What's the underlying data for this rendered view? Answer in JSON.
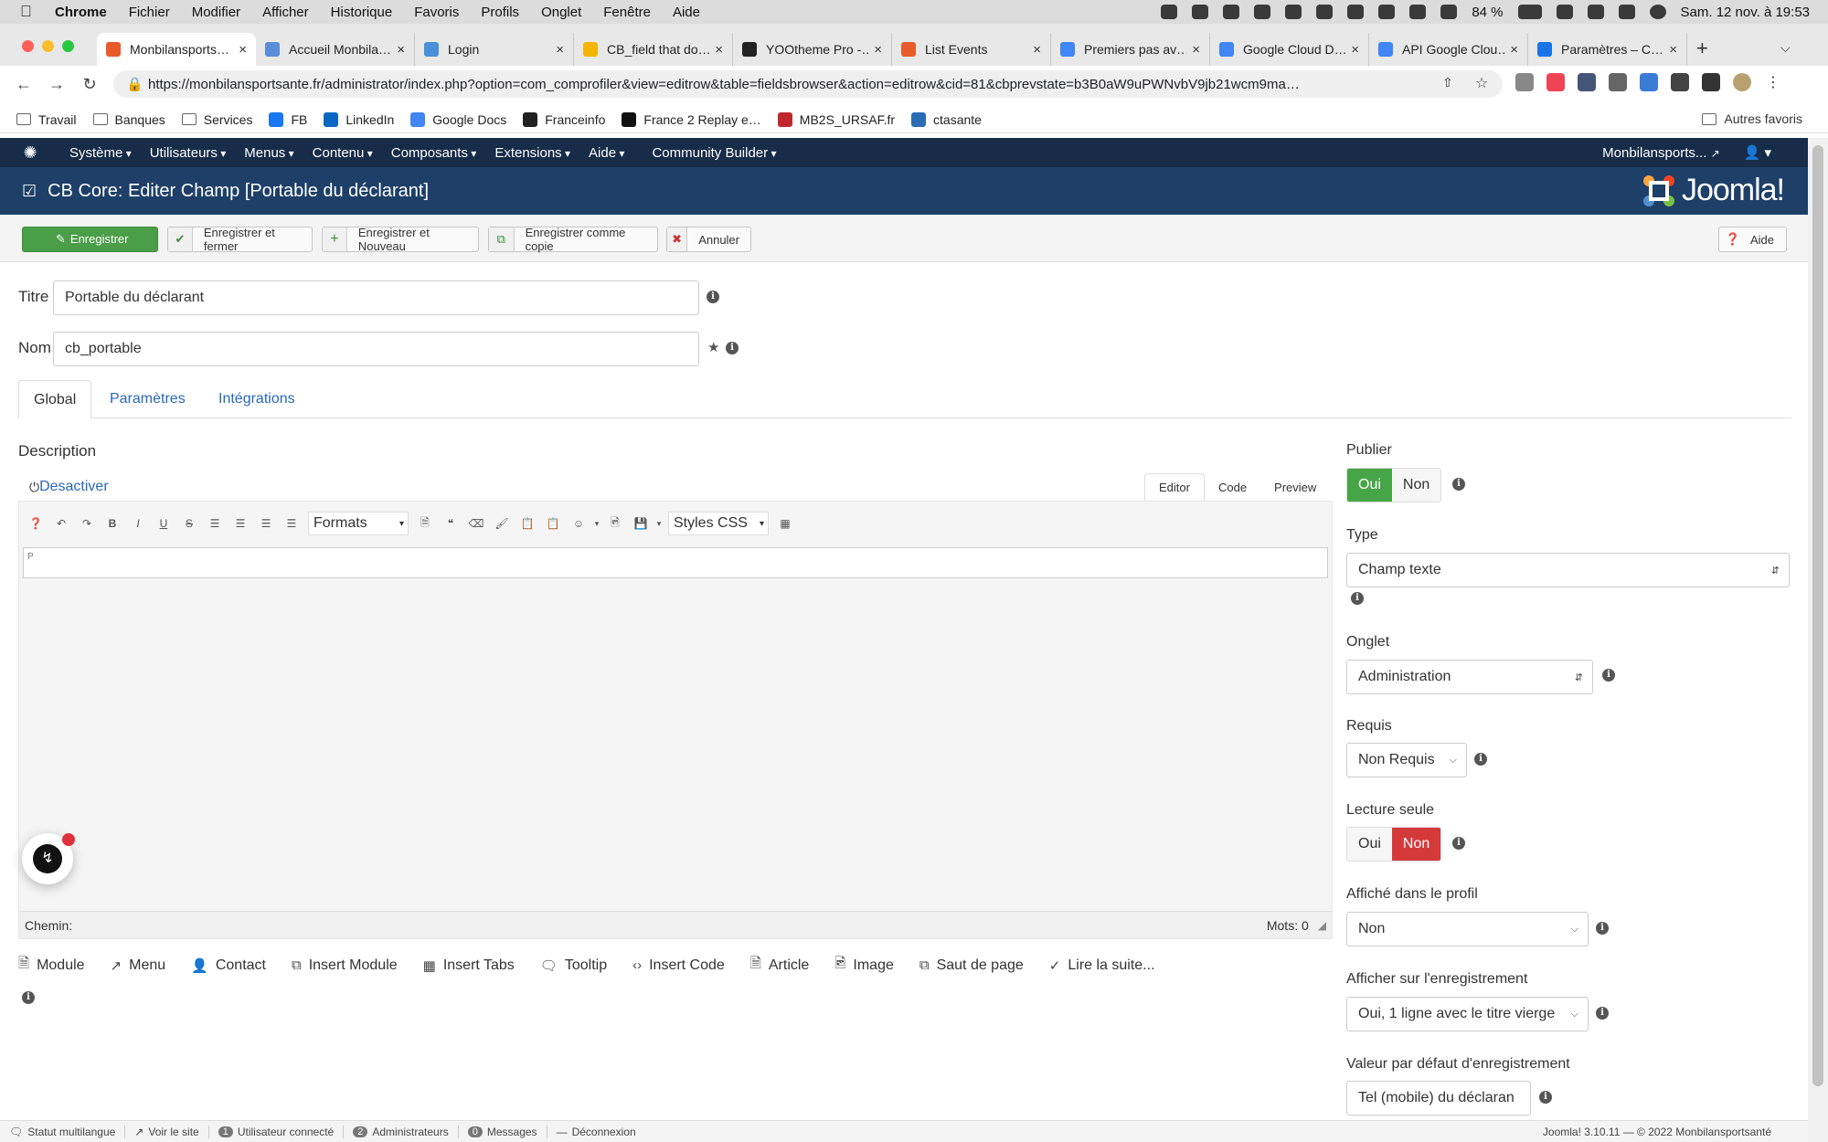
{
  "mac": {
    "app": "Chrome",
    "menus": [
      "Fichier",
      "Modifier",
      "Afficher",
      "Historique",
      "Favoris",
      "Profils",
      "Onglet",
      "Fenêtre",
      "Aide"
    ],
    "battery": "84 %",
    "clock": "Sam. 12 nov. à 19:53"
  },
  "browser": {
    "tabs": [
      {
        "title": "Monbilansports…",
        "color": "#e85c2c"
      },
      {
        "title": "Accueil Monbila…",
        "color": "#5b8dd8"
      },
      {
        "title": "Login",
        "color": "#4a90d9"
      },
      {
        "title": "CB_field that do…",
        "color": "#f2b600"
      },
      {
        "title": "YOOtheme Pro -…",
        "color": "#222222"
      },
      {
        "title": "List Events",
        "color": "#e85c2c"
      },
      {
        "title": "Premiers pas av…",
        "color": "#4285f4"
      },
      {
        "title": "Google Cloud D…",
        "color": "#4285f4"
      },
      {
        "title": "API Google Clou…",
        "color": "#4285f4"
      },
      {
        "title": "Paramètres – C…",
        "color": "#1a73e8"
      }
    ],
    "url_host": "https://monbilansportsante.fr",
    "url_path": "/administrator/index.php?option=com_comprofiler&view=editrow&table=fieldsbrowser&action=editrow&cid=81&cbprevstate=b3B0aW9uPWNvbV9jb21wcm9ma…",
    "bookmarks": [
      {
        "label": "Travail",
        "type": "folder"
      },
      {
        "label": "Banques",
        "type": "folder"
      },
      {
        "label": "Services",
        "type": "folder"
      },
      {
        "label": "FB",
        "type": "site",
        "color": "#1877f2"
      },
      {
        "label": "LinkedIn",
        "type": "site",
        "color": "#0a66c2"
      },
      {
        "label": "Google Docs",
        "type": "site",
        "color": "#4285f4"
      },
      {
        "label": "Franceinfo",
        "type": "site",
        "color": "#222222"
      },
      {
        "label": "France 2 Replay e…",
        "type": "site",
        "color": "#111111"
      },
      {
        "label": "MB2S_URSAF.fr",
        "type": "site",
        "color": "#c0272d"
      },
      {
        "label": "ctasante",
        "type": "site",
        "color": "#2a6db5"
      }
    ],
    "bookmarks_other": "Autres favoris"
  },
  "joomla": {
    "nav": [
      "Système",
      "Utilisateurs",
      "Menus",
      "Contenu",
      "Composants",
      "Extensions",
      "Aide",
      "Community Builder"
    ],
    "site_link": "Monbilansports...",
    "page_title": "CB Core: Editer Champ [Portable du déclarant]",
    "brand": "Joomla!",
    "toolbar": {
      "save": "Enregistrer",
      "save_close": "Enregistrer et fermer",
      "save_new": "Enregistrer et Nouveau",
      "save_copy": "Enregistrer comme copie",
      "cancel": "Annuler",
      "help": "Aide"
    },
    "form": {
      "title_label": "Titre",
      "title_value": "Portable du déclarant",
      "name_label": "Nom",
      "name_value": "cb_portable"
    },
    "tabs": [
      "Global",
      "Paramètres",
      "Intégrations"
    ],
    "description_label": "Description",
    "editor": {
      "toggle": "Desactiver",
      "modes": [
        "Editor",
        "Code",
        "Preview"
      ],
      "formats": "Formats",
      "styles": "Styles CSS",
      "content": "P",
      "path_label": "Chemin:",
      "words": "Mots: 0"
    },
    "editor_buttons": [
      "Module",
      "Menu",
      "Contact",
      "Insert Module",
      "Insert Tabs",
      "Tooltip",
      "Insert Code",
      "Article",
      "Image",
      "Saut de page",
      "Lire la suite..."
    ],
    "right": {
      "publier_label": "Publier",
      "publier_yes": "Oui",
      "publier_no": "Non",
      "type_label": "Type",
      "type_value": "Champ texte",
      "onglet_label": "Onglet",
      "onglet_value": "Administration",
      "requis_label": "Requis",
      "requis_value": "Non Requis",
      "lecture_label": "Lecture seule",
      "lecture_yes": "Oui",
      "lecture_no": "Non",
      "profil_label": "Affiché dans le profil",
      "profil_value": "Non",
      "enreg_label": "Afficher sur l'enregistrement",
      "enreg_value": "Oui, 1 ligne avec le titre vierge",
      "defaut_label": "Valeur par défaut d'enregistrement",
      "defaut_value": "Tel (mobile) du déclaran"
    },
    "footer": {
      "multilang": "Statut multilangue",
      "view_site": "Voir le site",
      "users_count": "1",
      "users_label": "Utilisateur connecté",
      "admins_count": "2",
      "admins_label": "Administrateurs",
      "messages_count": "0",
      "messages_label": "Messages",
      "logout": "Déconnexion",
      "version": "Joomla! 3.10.11  —  © 2022 Monbilansportsanté"
    }
  },
  "colors": {
    "nav_bg": "#162c48",
    "header_bg": "#1d3f68",
    "save_green": "#4a9e48",
    "yes_green": "#46a546",
    "no_red": "#d43a3a",
    "link_blue": "#2a69b8"
  }
}
